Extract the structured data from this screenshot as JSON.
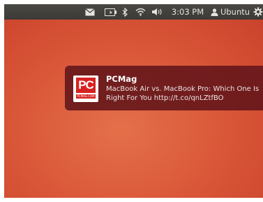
{
  "panel": {
    "icons": [
      "mail-icon",
      "battery-icon",
      "bluetooth-icon",
      "wifi-icon",
      "volume-icon",
      "gear-icon"
    ],
    "clock": "3:03 PM",
    "user": "Ubuntu"
  },
  "notification": {
    "logo": {
      "letters": "PC",
      "caption": "PCMAG.COM"
    },
    "title": "PCMag",
    "body": "MacBook Air vs. MacBook Pro: Which One Is Right For You http://t.co/qnLZtfBO"
  },
  "colors": {
    "panel": "#3c3b37",
    "desktop": "#d85436",
    "notification": "#62141a",
    "logo_red": "#d82020"
  }
}
